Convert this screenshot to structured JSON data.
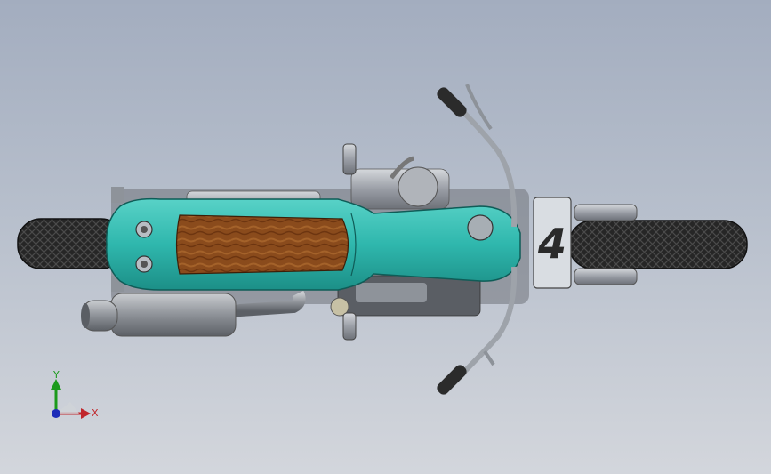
{
  "viewport": {
    "background_top": "#a3adbf",
    "background_bottom": "#d3d6dc"
  },
  "model": {
    "body_color": "#2fb7ad",
    "seat_color": "#8a4b1c",
    "tire_color": "#1f1f1f",
    "metal_color": "#9a9ea6",
    "plate_glyph": "4"
  },
  "triad": {
    "y_label": "Y",
    "x_label": "X",
    "y_color": "#1b9a1b",
    "x_color": "#c0262b",
    "z_color": "#1c2bb8"
  }
}
